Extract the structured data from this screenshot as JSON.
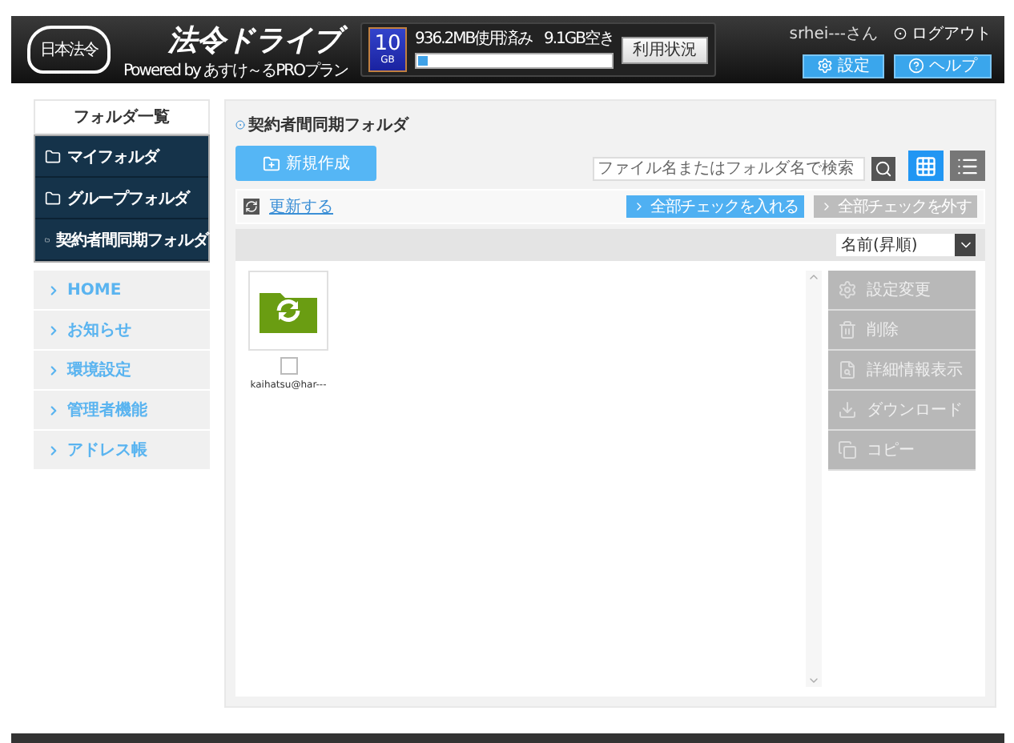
{
  "header": {
    "logo_badge": "日本法令",
    "logo_title": "法令ドライブ",
    "powered_by": "Powered by あすけ～るPROプラン",
    "storage": {
      "capacity": "10",
      "unit": "GB",
      "used": "936.2MB使用済み",
      "free": "9.1GB空き",
      "level": 0.05,
      "button": "利用状況"
    },
    "user": "srhei---さん",
    "logout": "ログアウト",
    "buttons": [
      {
        "label": "設定",
        "kind": "settings"
      },
      {
        "label": "ヘルプ",
        "kind": "help"
      }
    ]
  },
  "sidebar": {
    "title": "フォルダ一覧",
    "folders": [
      "マイフォルダ",
      "グループフォルダ",
      "契約者間同期フォルダ"
    ],
    "menu": [
      "HOME",
      "お知らせ",
      "環境設定",
      "管理者機能",
      "アドレス帳"
    ]
  },
  "main": {
    "title": "契約者間同期フォルダ",
    "new_button": "新規作成",
    "search": {
      "placeholder": "ファイル名またはフォルダ名で検索"
    },
    "views": [
      {
        "kind": "grid",
        "selected": true
      },
      {
        "kind": "list",
        "selected": false
      }
    ],
    "refresh": "更新する",
    "check_buttons": [
      {
        "label": "全部チェックを入れる",
        "disabled": false
      },
      {
        "label": "全部チェックを外す",
        "disabled": true
      }
    ],
    "sort": "名前(昇順)",
    "files": [
      {
        "name": "kaihatsu@har---",
        "checked": false
      }
    ],
    "actions": [
      {
        "label": "設定変更",
        "kind": "settings",
        "disabled": true
      },
      {
        "label": "削除",
        "kind": "delete",
        "disabled": true
      },
      {
        "label": "詳細情報表示",
        "kind": "details",
        "disabled": true
      },
      {
        "label": "ダウンロード",
        "kind": "download",
        "disabled": true
      },
      {
        "label": "コピー",
        "kind": "copy",
        "disabled": true
      }
    ]
  }
}
